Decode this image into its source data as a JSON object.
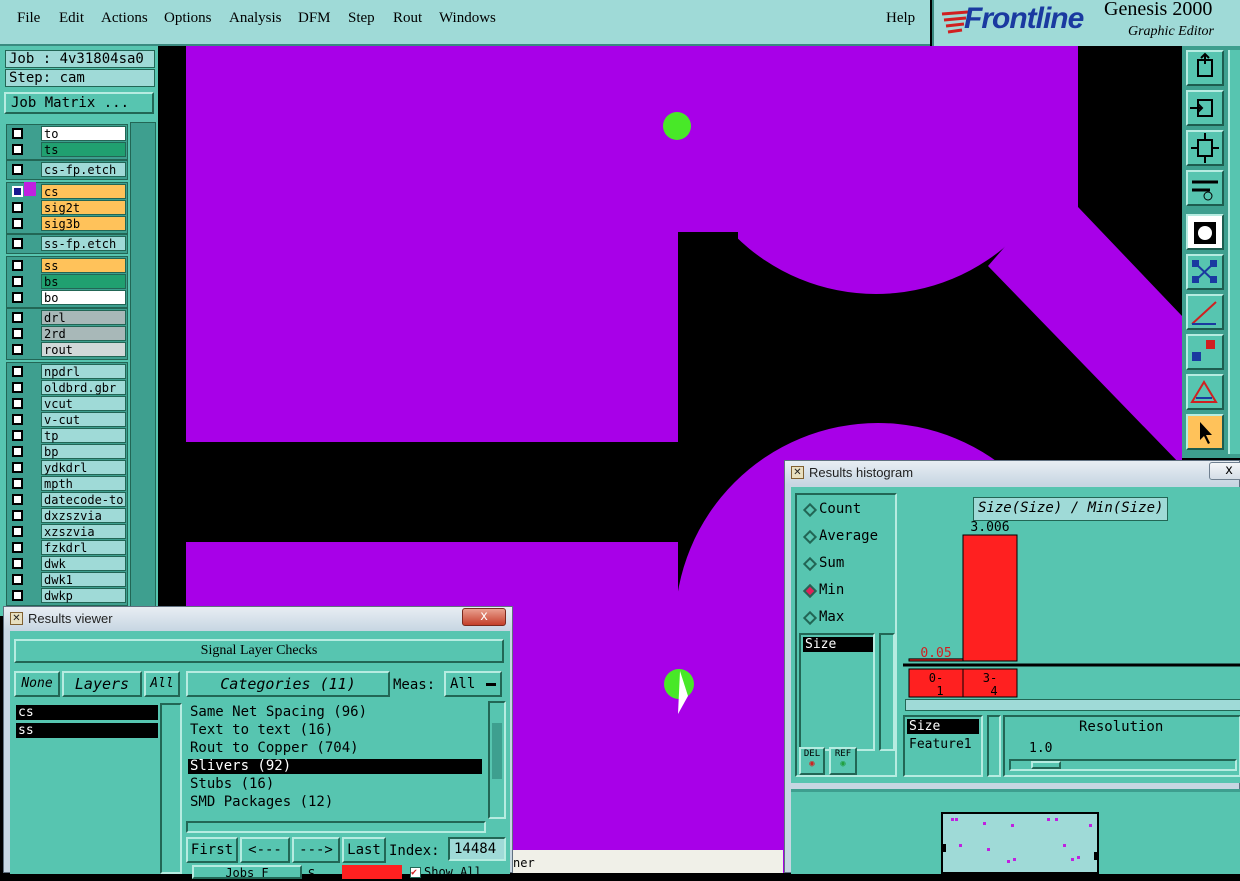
{
  "menu": {
    "items": [
      "File",
      "Edit",
      "Actions",
      "Options",
      "Analysis",
      "DFM",
      "Step",
      "Rout",
      "Windows"
    ],
    "help": "Help"
  },
  "brand": {
    "logo": "Frontline",
    "product": "Genesis 2000",
    "subtitle": "Graphic Editor"
  },
  "job": {
    "job_label": "Job : 4v31804sa0",
    "step_label": "Step: cam",
    "matrix_button": "Job Matrix ..."
  },
  "layers": [
    {
      "name": "to",
      "color": "#ffffff"
    },
    {
      "name": "ts",
      "color": "#20a070"
    },
    {
      "name": "cs-fp.etch",
      "color": "#9fdad7"
    },
    {
      "name": "cs",
      "color": "#ffc25a"
    },
    {
      "name": "sig2t",
      "color": "#ffc25a"
    },
    {
      "name": "sig3b",
      "color": "#ffc25a"
    },
    {
      "name": "ss-fp.etch",
      "color": "#9fdad7"
    },
    {
      "name": "ss",
      "color": "#ffc25a"
    },
    {
      "name": "bs",
      "color": "#20a070"
    },
    {
      "name": "bo",
      "color": "#ffffff"
    },
    {
      "name": "drl",
      "color": "#a8b8b8"
    },
    {
      "name": "2rd",
      "color": "#a8b8b8"
    },
    {
      "name": "rout",
      "color": "#d0d8d8"
    },
    {
      "name": "npdrl",
      "color": "#9fdad7"
    },
    {
      "name": "oldbrd.gbr",
      "color": "#9fdad7"
    },
    {
      "name": "vcut",
      "color": "#9fdad7"
    },
    {
      "name": "v-cut",
      "color": "#9fdad7"
    },
    {
      "name": "tp",
      "color": "#9fdad7"
    },
    {
      "name": "bp",
      "color": "#9fdad7"
    },
    {
      "name": "ydkdrl",
      "color": "#9fdad7"
    },
    {
      "name": "mpth",
      "color": "#9fdad7"
    },
    {
      "name": "datecode-to",
      "color": "#9fdad7"
    },
    {
      "name": "dxzszvia",
      "color": "#9fdad7"
    },
    {
      "name": "xzszvia",
      "color": "#9fdad7"
    },
    {
      "name": "fzkdrl",
      "color": "#9fdad7"
    },
    {
      "name": "dwk",
      "color": "#9fdad7"
    },
    {
      "name": "dwk1",
      "color": "#9fdad7"
    },
    {
      "name": "dwkp",
      "color": "#9fdad7"
    }
  ],
  "results_viewer": {
    "title": "Results viewer",
    "close": "x",
    "header": "Signal Layer Checks",
    "none": "None",
    "layers": "Layers",
    "all": "All",
    "categories_label": "Categories (11)",
    "meas_label": "Meas:",
    "meas_value": "All",
    "layer_list": [
      "cs",
      "ss"
    ],
    "categories": [
      "Same Net Spacing (96)",
      "Text to text (16)",
      "Rout to Copper (704)",
      "Slivers (92)",
      "Stubs (16)",
      "SMD Packages (12)"
    ],
    "first": "First",
    "prev": "<---",
    "next": "--->",
    "last": "Last",
    "index_label": "Index:",
    "index_value": "14484",
    "show_all": "Show All",
    "bottom_left": "Jobs F",
    "bottom_mid": "S"
  },
  "histogram": {
    "title": "Results histogram",
    "close": "x",
    "modes": [
      "Count",
      "Average",
      "Sum",
      "Min",
      "Max"
    ],
    "selected_mode": "Min",
    "size_item": "Size",
    "del": "DEL",
    "ref": "REF",
    "chart_title": "Size(Size) / Min(Size)",
    "feature_list": [
      "Size",
      "Feature1"
    ],
    "resolution_label": "Resolution",
    "resolution_value": "1.0"
  },
  "chart_data": {
    "type": "bar",
    "title": "Size(Size) / Min(Size)",
    "categories": [
      "0-1",
      "3-4"
    ],
    "values": [
      0.05,
      3.006
    ],
    "value_labels": [
      "0.05",
      "3.006"
    ],
    "bar_color": "#ff2020"
  },
  "status": {
    "fragment": "ner"
  },
  "colors": {
    "copper": "#a800e8",
    "pad": "#48e828",
    "background": "#000000",
    "panel": "#57c5b0"
  }
}
